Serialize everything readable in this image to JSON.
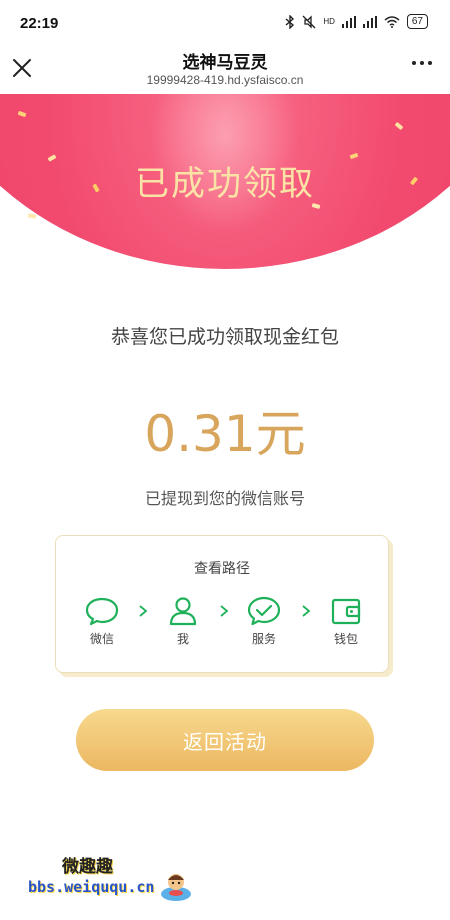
{
  "status_bar": {
    "time": "22:19",
    "icons": [
      "bluetooth-icon",
      "mute-icon",
      "signal-icon",
      "signal-icon",
      "wifi-icon"
    ],
    "hd_label": "HD",
    "battery": "67"
  },
  "nav": {
    "title": "选神马豆灵",
    "url": "19999428-419.hd.ysfaisco.cn"
  },
  "banner": {
    "title": "已成功领取",
    "colors": {
      "background": "#f24a6f",
      "title": "#fbe3a6"
    }
  },
  "main": {
    "congrats": "恭喜您已成功领取现金红包",
    "amount": "0.31元",
    "note": "已提现到您的微信账号"
  },
  "path_card": {
    "title": "查看路径",
    "steps": [
      {
        "label": "微信",
        "icon": "chat-bubble-icon"
      },
      {
        "label": "我",
        "icon": "person-icon"
      },
      {
        "label": "服务",
        "icon": "check-circle-icon"
      },
      {
        "label": "钱包",
        "icon": "wallet-icon"
      }
    ],
    "accent": "#1fb15a"
  },
  "button": {
    "label": "返回活动",
    "color": "#ecb761"
  },
  "watermark": {
    "name": "微趣趣",
    "url": "bbs.weiququ.cn"
  }
}
